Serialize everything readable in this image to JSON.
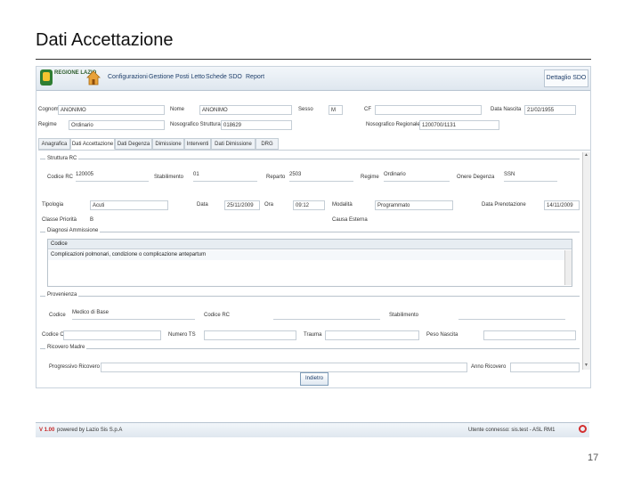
{
  "slide": {
    "title": "Dati Accettazione",
    "page_number": "17"
  },
  "app": {
    "logo_text": "REGIONE LAZIO",
    "menu": [
      "Configurazioni",
      "Gestione Posti Letto",
      "Schede SDO",
      "Report"
    ],
    "detail_button": "Dettaglio SDO"
  },
  "patient": {
    "cognome_label": "Cognome",
    "cognome": "ANONIMO",
    "nome_label": "Nome",
    "nome": "ANONIMO",
    "sesso_label": "Sesso",
    "sesso": "M",
    "cf_label": "CF",
    "cf": "",
    "data_nascita_label": "Data Nascita",
    "data_nascita": "21/02/1955",
    "regime_label": "Regime",
    "regime": "Ordinario",
    "nosografico_struttura_label": "Nosografico Struttura",
    "nosografico_struttura": "018629",
    "nosografico_regionale_label": "Nosografico Regionale",
    "nosografico_regionale": "1200700/1131"
  },
  "tabs": [
    "Anagrafica",
    "Dati Accettazione",
    "Dati Degenza",
    "Dimissione",
    "Interventi",
    "Dati Dimissione",
    "DRG"
  ],
  "struttura_rc": {
    "section": "Struttura RC",
    "codice_rc_label": "Codice RC",
    "codice_rc": "120005",
    "stabilimento_label": "Stabilimento",
    "stabilimento": "01",
    "reparto_label": "Reparto",
    "reparto": "2503",
    "regime_label": "Regime",
    "regime": "Ordinario",
    "onere_label": "Onere Degenza",
    "onere": "SSN",
    "tipologia_label": "Tipologia",
    "tipologia": "Acuti",
    "data_label": "Data",
    "data": "25/11/2009",
    "ora_label": "Ora",
    "ora": "09:12",
    "modalita_label": "Modalità",
    "modalita": "Programmato",
    "data_prenotazione_label": "Data Prenotazione",
    "data_prenotazione": "14/11/2009",
    "classe_priorita_label": "Classe Priorità",
    "classe_priorita": "B",
    "causa_esterna_label": "Causa Esterna",
    "causa_esterna": ""
  },
  "diagnosi": {
    "section": "Diagnosi Ammissione",
    "column": "Codice",
    "row": "Complicazioni polmonari, condizione o complicazione antepartum"
  },
  "provenienza": {
    "section": "Provenienza",
    "codice_label": "Codice",
    "codice": "Medico di Base",
    "codice_rc_label": "Codice RC",
    "codice_rc": "",
    "stabilimento_label": "Stabilimento",
    "stabilimento": "",
    "ciu_label": "Codice CIU",
    "ciu": "",
    "numero_ts_label": "Numero TS",
    "numero_ts": "",
    "trauma_label": "Trauma",
    "trauma": "",
    "peso_label": "Peso Nascita",
    "peso": ""
  },
  "ricovero": {
    "section": "Ricovero Madre",
    "progressivo_label": "Progressivo Ricovero",
    "progressivo": "",
    "anno_label": "Anno Ricovero",
    "anno": ""
  },
  "back_button": "Indietro",
  "footer": {
    "version": "V 1.00",
    "powered": "powered by Lazio Sis S.p.A",
    "user": "Utente connesso: sis.test - ASL RM1"
  }
}
